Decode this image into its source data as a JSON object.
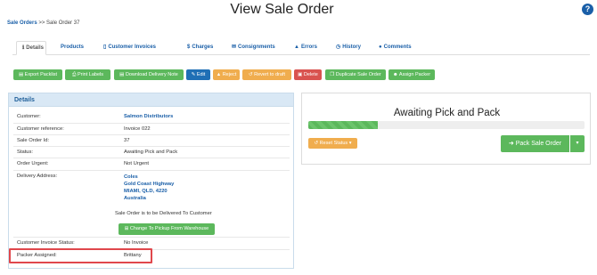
{
  "header": {
    "title": "View Sale Order",
    "help_icon": "?"
  },
  "breadcrumb": {
    "link": "Sale Orders",
    "separator": ">>",
    "current": "Sale Order 37"
  },
  "tabs": [
    {
      "label": "Details",
      "icon": "info-icon"
    },
    {
      "label": "Products",
      "icon": ""
    },
    {
      "label": "Customer Invoices",
      "icon": "file-icon"
    },
    {
      "label": "Charges",
      "icon": "dollar-icon"
    },
    {
      "label": "Consignments",
      "icon": "envelope-icon"
    },
    {
      "label": "Errors",
      "icon": "warning-icon"
    },
    {
      "label": "History",
      "icon": "clock-icon"
    },
    {
      "label": "Comments",
      "icon": "comments-icon"
    }
  ],
  "toolbar": {
    "export_packlist": "Export Packlist",
    "print_labels": "Print Labels",
    "download_delivery_note": "Download Delivery Note",
    "edit": "Edit",
    "reject": "Reject",
    "revert_to_draft": "Revert to draft",
    "delete": "Delete",
    "duplicate": "Duplicate Sale Order",
    "assign_packer": "Assign Packer"
  },
  "details": {
    "heading": "Details",
    "rows": [
      {
        "label": "Customer:",
        "value": "Salmon Distributors"
      },
      {
        "label": "Customer reference:",
        "value": "Invoice 022"
      },
      {
        "label": "Sale Order Id:",
        "value": "37"
      },
      {
        "label": "Status:",
        "value": "Awaiting Pick and Pack"
      },
      {
        "label": "Order Urgent:",
        "value": "Not Urgent"
      },
      {
        "label": "Delivery Address:",
        "value": ""
      },
      {
        "label": "Customer Invoice Status:",
        "value": "No Invoice"
      },
      {
        "label": "Packer Assigned:",
        "value": "Brittany"
      }
    ],
    "address": [
      "Coles",
      "Gold Coast Highway",
      "MIAMI, QLD, 4220",
      "Australia"
    ],
    "delivery_note": "Sale Order is to be Delivered To Customer",
    "change_button": "Change To Pickup From Warehouse"
  },
  "status_panel": {
    "title": "Awaiting Pick and Pack",
    "progress_fraction": 0.25,
    "reset_button": "Reset Status",
    "pack_button": "Pack Sale Order"
  },
  "colors": {
    "green": "#5cb85c",
    "blue": "#1f6fb5",
    "orange": "#f0ad4e",
    "red": "#d9534f",
    "highlight": "#e0474c"
  }
}
